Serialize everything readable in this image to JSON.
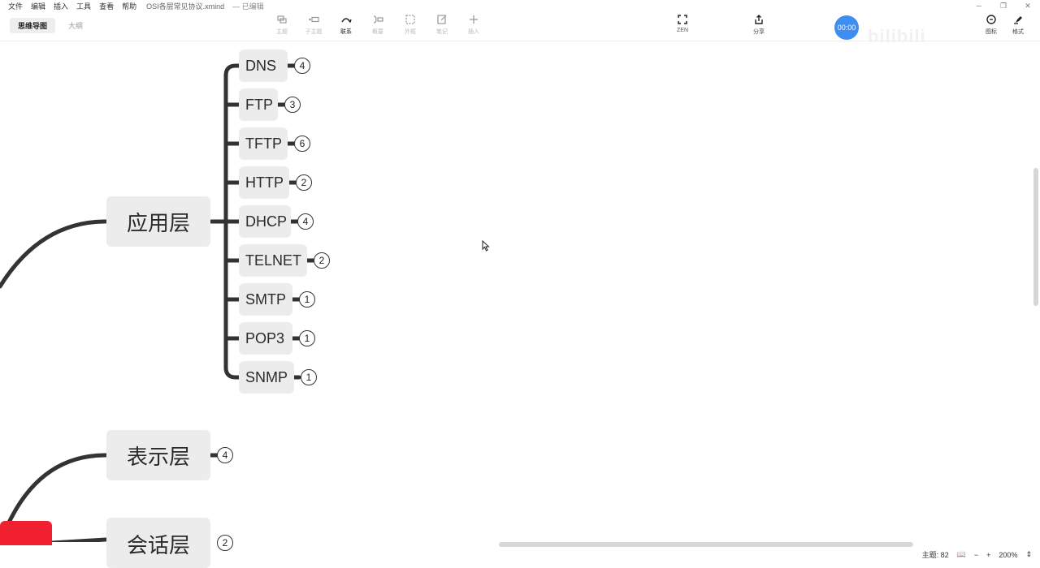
{
  "menu": {
    "items": [
      "文件",
      "编辑",
      "插入",
      "工具",
      "查看",
      "帮助"
    ],
    "document_title": "OSI各层常见协议.xmind",
    "doc_status": "— 已编辑"
  },
  "view_tabs": {
    "mindmap": "思维导图",
    "outline": "大纲"
  },
  "toolbar": {
    "topic": "主题",
    "subtopic": "子主题",
    "relationship": "联系",
    "summary": "概要",
    "boundary": "外框",
    "note": "笔记",
    "insert": "插入",
    "zen": "ZEN",
    "share": "分享",
    "icons": "图标",
    "format": "格式"
  },
  "timer": "00:00",
  "watermark": "bilibili",
  "mindmap": {
    "app_layer": {
      "label": "应用层",
      "children": [
        {
          "label": "DNS",
          "count": "4"
        },
        {
          "label": "FTP",
          "count": "3"
        },
        {
          "label": "TFTP",
          "count": "6"
        },
        {
          "label": "HTTP",
          "count": "2"
        },
        {
          "label": "DHCP",
          "count": "4"
        },
        {
          "label": "TELNET",
          "count": "2"
        },
        {
          "label": "SMTP",
          "count": "1"
        },
        {
          "label": "POP3",
          "count": "1"
        },
        {
          "label": "SNMP",
          "count": "1"
        }
      ]
    },
    "presentation_layer": {
      "label": "表示层",
      "count": "4"
    },
    "session_layer": {
      "label": "会话层",
      "count": "2"
    }
  },
  "status": {
    "topic_count": "主题: 82",
    "zoom": "200%"
  },
  "colors": {
    "accent": "#3d8ef0",
    "root": "#f02030",
    "node_bg": "#ececec",
    "line": "#333333"
  }
}
